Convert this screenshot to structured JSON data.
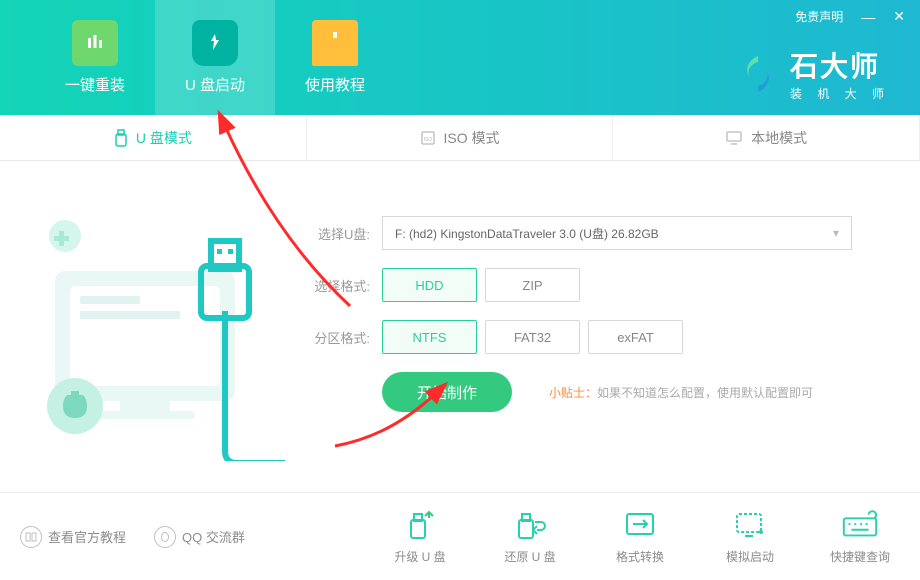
{
  "titlebar": {
    "disclaimer": "免责声明"
  },
  "brand": {
    "title": "石大师",
    "subtitle": "装 机 大 师"
  },
  "header_tabs": {
    "reinstall": "一键重装",
    "usb_boot": "U 盘启动",
    "tutorial": "使用教程"
  },
  "mode_tabs": {
    "usb": "U 盘模式",
    "iso": "ISO 模式",
    "local": "本地模式"
  },
  "form": {
    "select_usb_label": "选择U盘:",
    "select_usb_value": "F: (hd2) KingstonDataTraveler 3.0 (U盘) 26.82GB",
    "select_format_label": "选择格式:",
    "partition_format_label": "分区格式:",
    "format_options": {
      "hdd": "HDD",
      "zip": "ZIP"
    },
    "partition_options": {
      "ntfs": "NTFS",
      "fat32": "FAT32",
      "exfat": "exFAT"
    },
    "start_button": "开始制作",
    "tip_label": "小贴士：",
    "tip_text": "如果不知道怎么配置，使用默认配置即可"
  },
  "bottom_links": {
    "official_tutorial": "查看官方教程",
    "qq_group": "QQ 交流群"
  },
  "bottom_actions": {
    "upgrade": "升级 U 盘",
    "restore": "还原 U 盘",
    "convert": "格式转换",
    "simulate": "模拟启动",
    "shortcuts": "快捷键查询"
  }
}
